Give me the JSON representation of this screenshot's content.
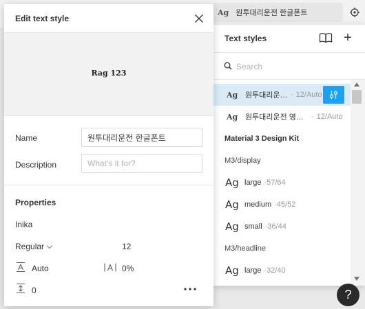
{
  "background": {
    "style_row": {
      "icon": "Ag",
      "name": "원투대리운전 한글폰트"
    },
    "target_icon": "target-icon"
  },
  "text_styles_panel": {
    "title": "Text styles",
    "library_icon": "book-icon",
    "add_icon": "plus-icon",
    "search": {
      "placeholder": "Search",
      "value": ""
    },
    "local_styles": [
      {
        "icon": "Ag",
        "name": "원투대리운전 한글폰트",
        "size": "12/Auto",
        "selected": true
      },
      {
        "icon": "Ag",
        "name": "원투대리운전 영문폰트",
        "size": "12/Auto",
        "selected": false
      }
    ],
    "group": {
      "title": "Material 3 Design Kit"
    },
    "display": {
      "label": "M3/display",
      "items": [
        {
          "icon": "Ag",
          "name": "large",
          "size": "57/64"
        },
        {
          "icon": "Ag",
          "name": "medium",
          "size": "45/52"
        },
        {
          "icon": "Ag",
          "name": "small",
          "size": "36/44"
        }
      ]
    },
    "headline": {
      "label": "M3/headline",
      "items": [
        {
          "icon": "Ag",
          "name": "large",
          "size": "32/40"
        }
      ]
    },
    "separator": "·"
  },
  "edit_panel": {
    "title": "Edit text style",
    "preview_text": "Rag 123",
    "name_label": "Name",
    "name_value": "원투대리운전 한글폰트",
    "description_label": "Description",
    "description_placeholder": "What's it for?",
    "properties_title": "Properties",
    "font_family": "Inika",
    "font_weight": "Regular",
    "font_size": "12",
    "line_height": "Auto",
    "letter_spacing": "0%",
    "paragraph_spacing": "0"
  },
  "help": {
    "label": "?"
  }
}
